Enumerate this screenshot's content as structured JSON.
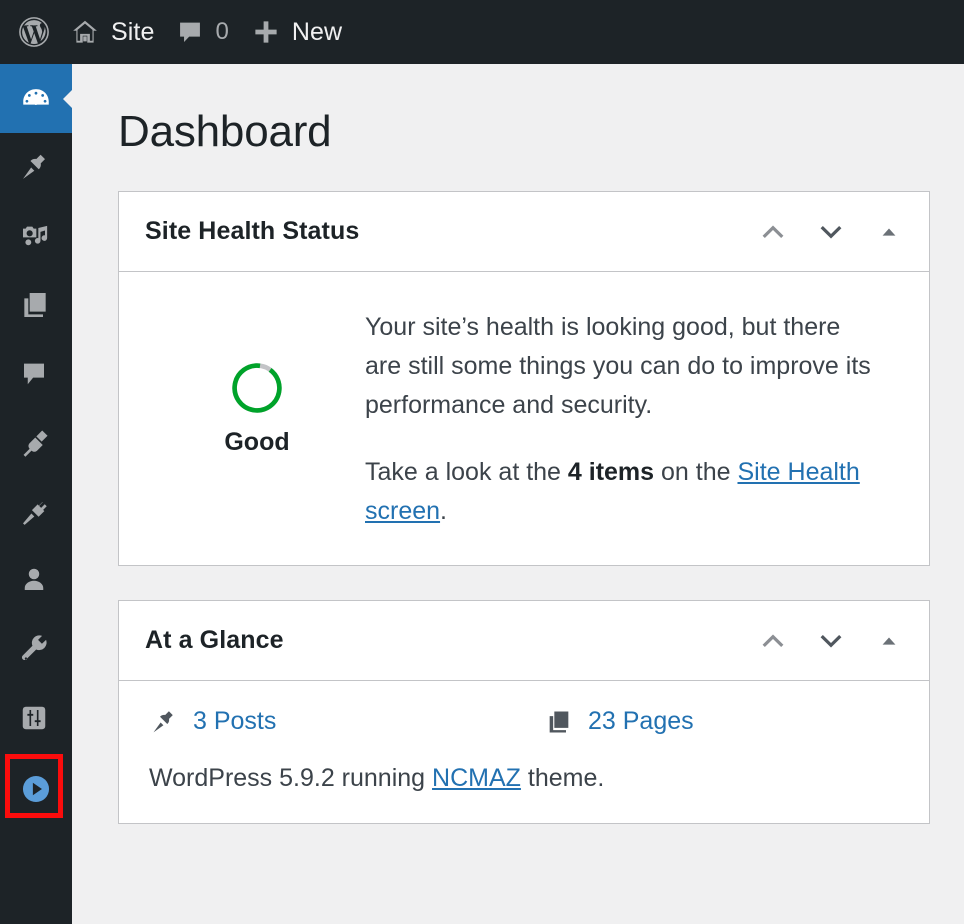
{
  "colors": {
    "admin_bar_bg": "#1d2327",
    "sidebar_bg": "#1d2327",
    "active_menu_bg": "#2271b1",
    "page_bg": "#f0f0f1",
    "panel_border": "#c3c4c7",
    "link": "#2271b1",
    "health_good_green": "#00a32a",
    "highlight_annotation": "#fb0c0c",
    "icon_gray": "#a7aaad"
  },
  "admin_bar": {
    "logo": {
      "icon": "wordpress-logo-icon",
      "label": ""
    },
    "site": {
      "icon": "home-icon",
      "label": "Site"
    },
    "comments": {
      "icon": "comment-bubble-icon",
      "count": "0"
    },
    "new": {
      "icon": "plus-icon",
      "label": "New"
    }
  },
  "sidebar": {
    "items": [
      {
        "name": "dashboard",
        "icon": "dashboard-gauge-icon",
        "active": true
      },
      {
        "name": "posts",
        "icon": "pin-icon",
        "active": false
      },
      {
        "name": "media",
        "icon": "media-camera-music-icon",
        "active": false
      },
      {
        "name": "pages",
        "icon": "pages-icon",
        "active": false
      },
      {
        "name": "comments",
        "icon": "comment-bubble-icon",
        "active": false
      },
      {
        "name": "appearance",
        "icon": "paintbrush-icon",
        "active": false
      },
      {
        "name": "plugins",
        "icon": "plug-icon",
        "active": false
      },
      {
        "name": "users",
        "icon": "user-icon",
        "active": false
      },
      {
        "name": "tools",
        "icon": "wrench-icon",
        "active": false
      },
      {
        "name": "settings",
        "icon": "sliders-icon",
        "active": false
      },
      {
        "name": "media-player",
        "icon": "play-circle-icon",
        "active": false,
        "highlighted": true
      }
    ]
  },
  "main": {
    "page_title": "Dashboard",
    "panels": [
      {
        "id": "site-health-status",
        "title": "Site Health Status",
        "actions": {
          "move_up": "move-up-chevron",
          "move_down": "move-down-chevron",
          "toggle": "toggle-panel-triangle"
        },
        "gauge": {
          "status_label": "Good",
          "status_color": "#00a32a",
          "percent": 92
        },
        "paragraph_1": "Your site’s health is looking good, but there are still some things you can do to improve its performance and security.",
        "paragraph_2_before": "Take a look at the ",
        "paragraph_2_bold": "4 items",
        "paragraph_2_middle": " on the ",
        "paragraph_2_link": "Site Health screen",
        "paragraph_2_after": "."
      },
      {
        "id": "at-a-glance",
        "title": "At a Glance",
        "actions": {
          "move_up": "move-up-chevron",
          "move_down": "move-down-chevron",
          "toggle": "toggle-panel-triangle"
        },
        "items": [
          {
            "icon": "pin-icon",
            "label": "3 Posts"
          },
          {
            "icon": "pages-icon",
            "label": "23 Pages"
          }
        ],
        "version_before": "WordPress 5.9.2 running ",
        "version_link": "NCMAZ",
        "version_after": " theme."
      }
    ]
  }
}
